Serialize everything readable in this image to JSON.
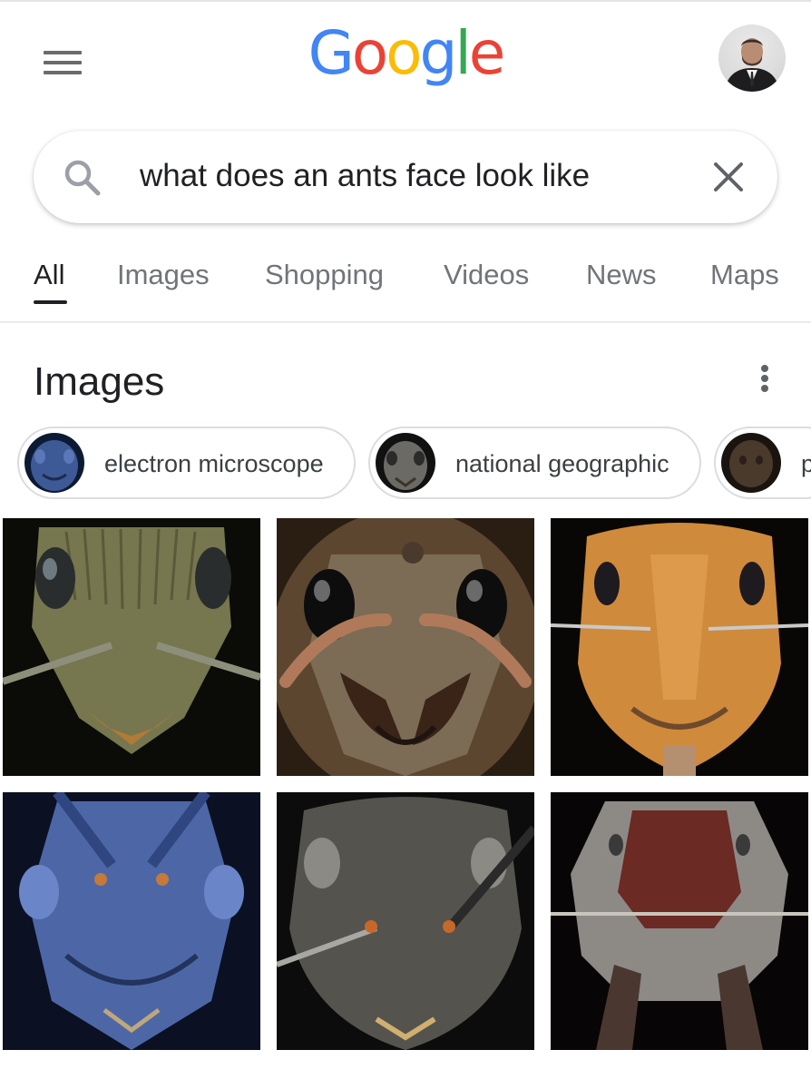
{
  "header": {
    "logo_letters": [
      "G",
      "o",
      "o",
      "g",
      "l",
      "e"
    ],
    "menu_icon": "hamburger-menu-icon",
    "avatar": "profile-photo"
  },
  "search": {
    "query": "what does an ants face look like",
    "search_icon": "search-icon",
    "clear_icon": "close-icon"
  },
  "tabs": [
    {
      "label": "All",
      "active": true
    },
    {
      "label": "Images",
      "active": false
    },
    {
      "label": "Shopping",
      "active": false
    },
    {
      "label": "Videos",
      "active": false
    },
    {
      "label": "News",
      "active": false
    },
    {
      "label": "Maps",
      "active": false
    }
  ],
  "images_section": {
    "title": "Images",
    "more_icon": "more-vert-icon",
    "chips": [
      {
        "label": "electron microscope",
        "thumb_color": "#2f4f86"
      },
      {
        "label": "national geographic",
        "thumb_color": "#6a6a64"
      },
      {
        "label": "p",
        "thumb_color": "#4a3a2c"
      }
    ],
    "results": [
      {
        "alt": "ant-face-greenish-sem",
        "base_color": "#7a7a58"
      },
      {
        "alt": "ant-face-brown-mandibles",
        "base_color": "#7a5a3a"
      },
      {
        "alt": "ant-face-orange",
        "base_color": "#d2893a"
      },
      {
        "alt": "ant-face-blue",
        "base_color": "#4f6aa8"
      },
      {
        "alt": "ant-face-dark-grey",
        "base_color": "#55534e"
      },
      {
        "alt": "ant-face-red-brown",
        "base_color": "#7a3a34"
      }
    ]
  },
  "colors": {
    "google_blue": "#4285f4",
    "google_red": "#ea4335",
    "google_yellow": "#fbbc05",
    "google_green": "#34a853",
    "tab_inactive": "#70757a",
    "text_primary": "#202124"
  }
}
